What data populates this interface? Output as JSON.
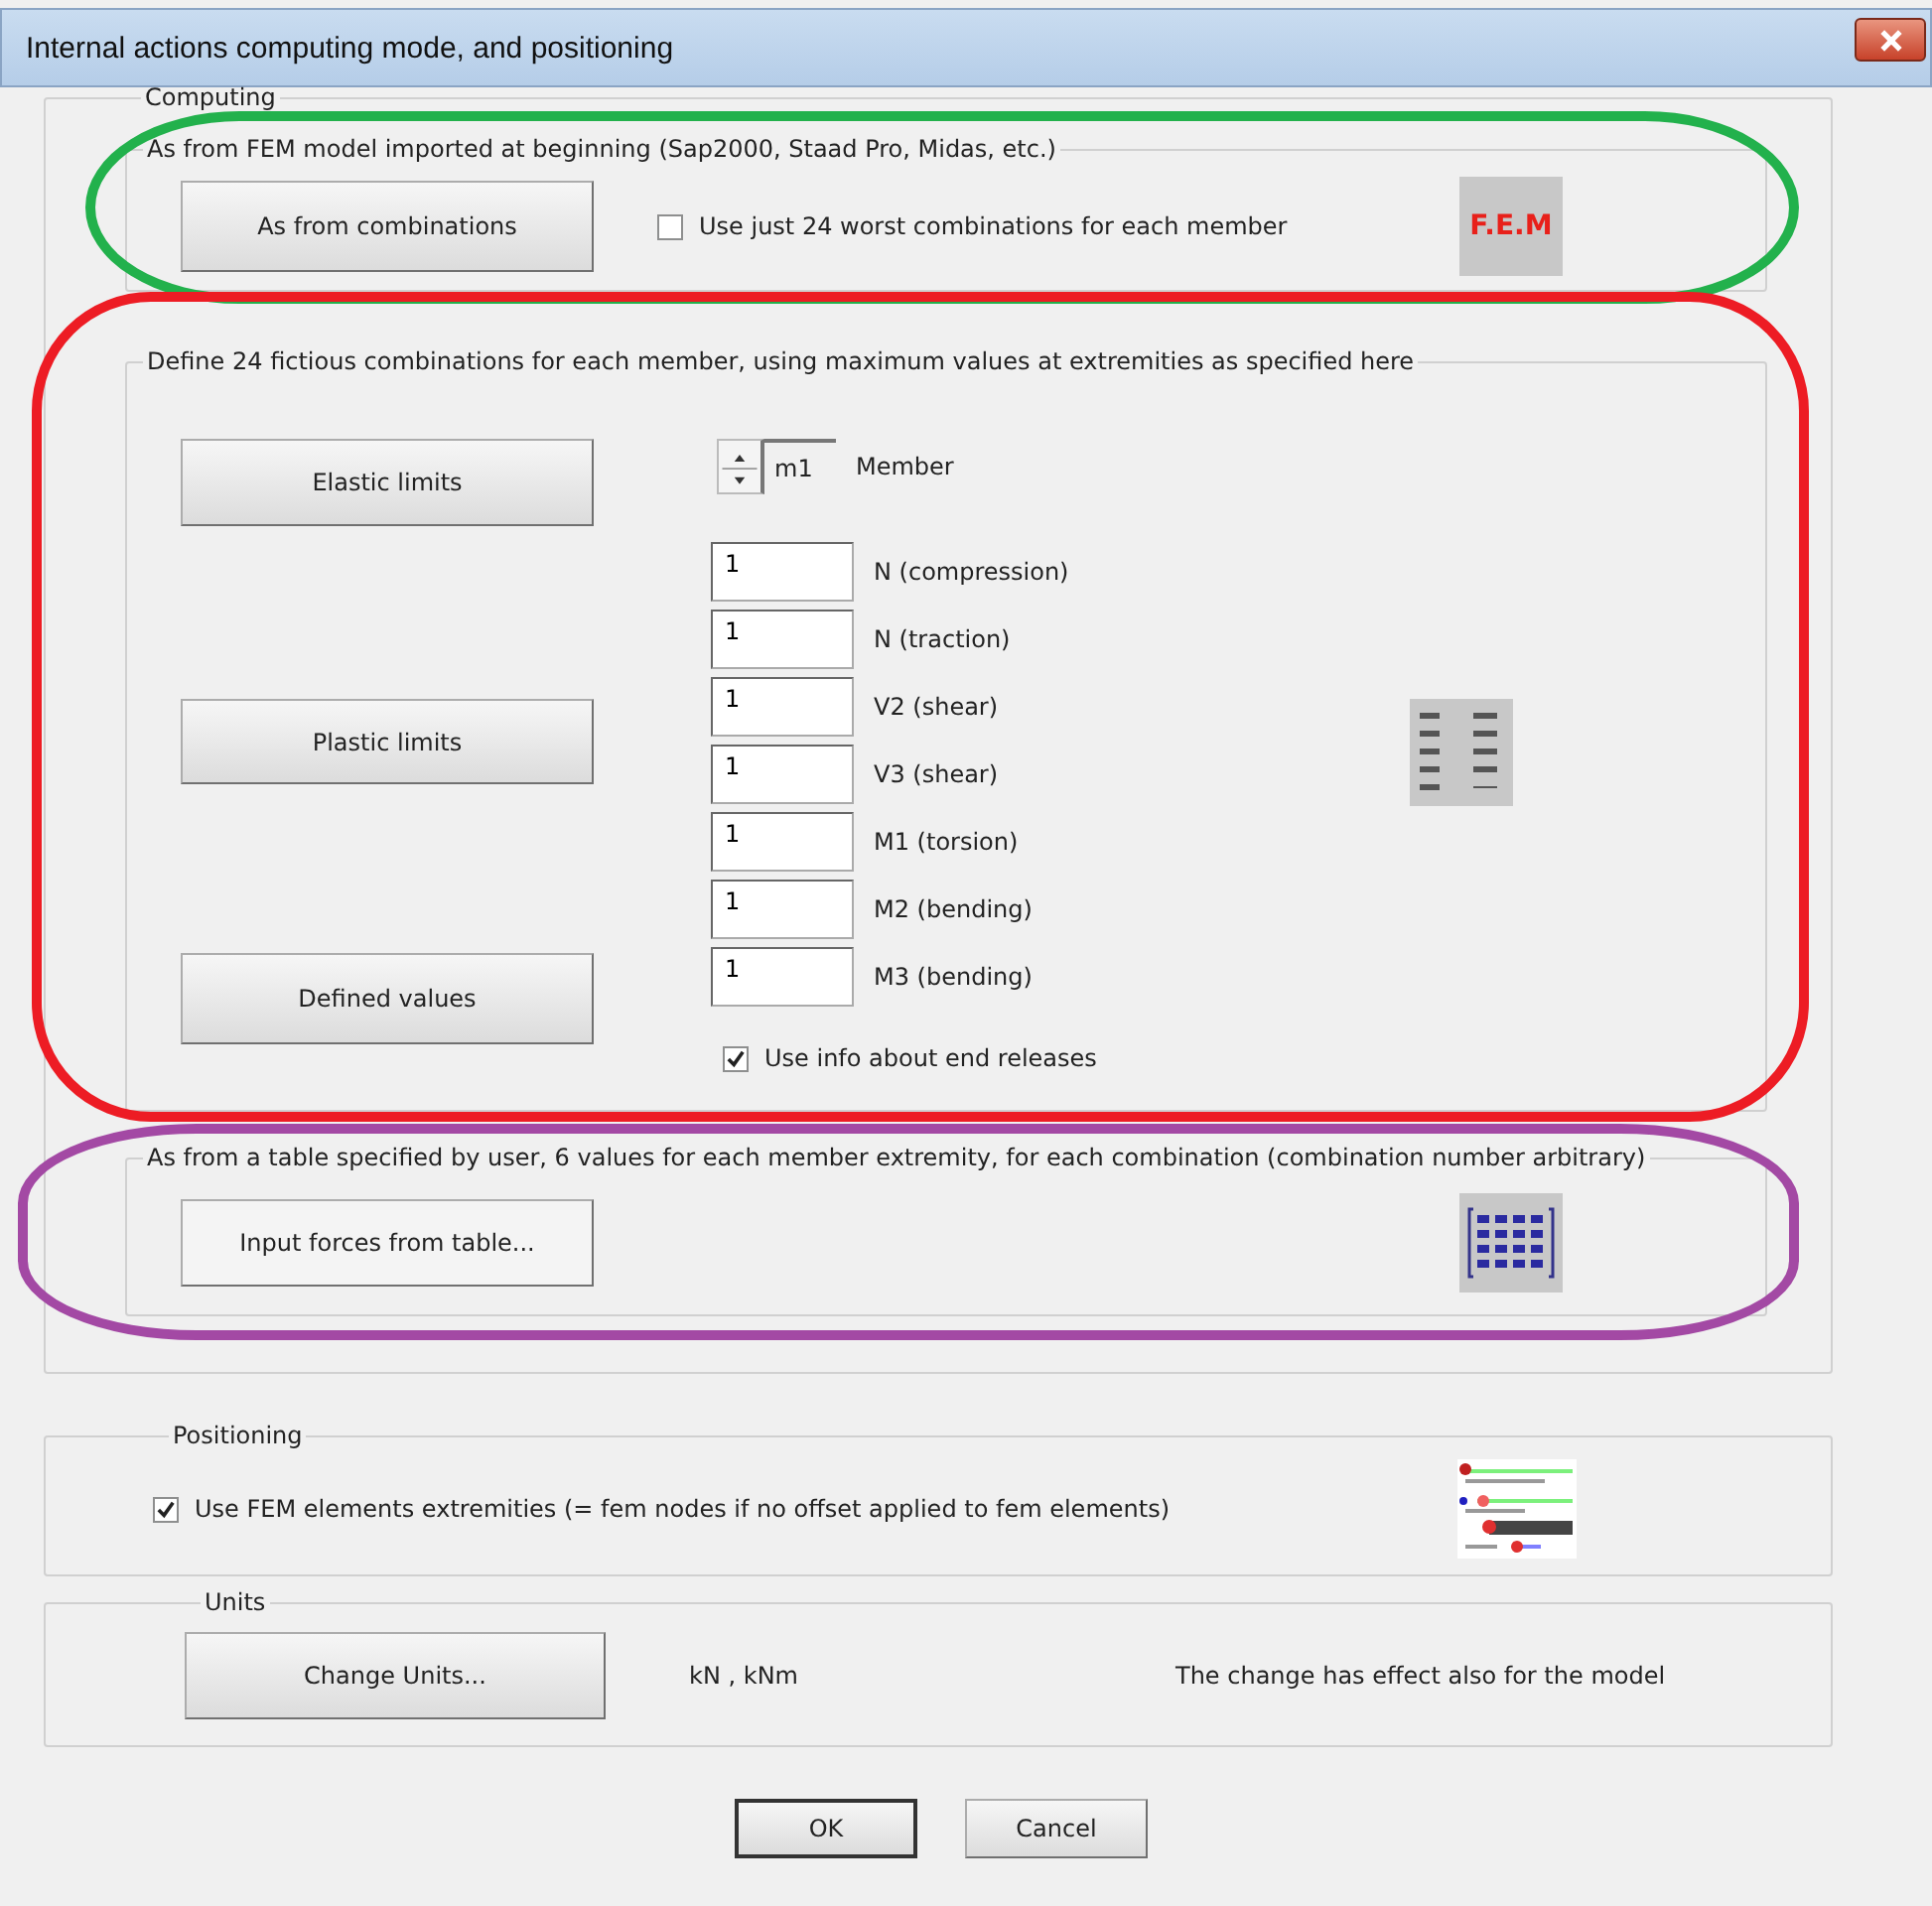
{
  "window": {
    "title": "Internal actions computing mode, and positioning"
  },
  "computing": {
    "label": "Computing",
    "fem_group": {
      "label": "As from FEM model imported at beginning (Sap2000, Staad Pro, Midas, etc.)",
      "color": "#22b14c",
      "button": "As from combinations",
      "worst_only": {
        "label": "Use just 24 worst combinations for each member",
        "checked": false
      },
      "badge": "F.E.M"
    },
    "fictitious_group": {
      "label": "Define 24 fictious combinations for each member, using maximum values at extremities as specified here",
      "color": "#ed1c24",
      "buttons": [
        "Elastic limits",
        "Plastic limits",
        "Defined values"
      ],
      "member": {
        "value": "m1",
        "label": "Member"
      },
      "values": [
        {
          "value": "1",
          "label": "N (compression)"
        },
        {
          "value": "1",
          "label": "N (traction)"
        },
        {
          "value": "1",
          "label": "V2 (shear)"
        },
        {
          "value": "1",
          "label": "V3 (shear)"
        },
        {
          "value": "1",
          "label": "M1 (torsion)"
        },
        {
          "value": "1",
          "label": "M2 (bending)"
        },
        {
          "value": "1",
          "label": "M3 (bending)"
        }
      ],
      "end_releases": {
        "label": "Use info about end releases",
        "checked": true
      }
    },
    "table_group": {
      "label": "As from a table specified by user, 6 values for each member extremity, for each combination (combination number arbitrary)",
      "color": "#a349a4",
      "button": "Input forces from table..."
    }
  },
  "positioning": {
    "label": "Positioning",
    "fem_extremities": {
      "label": "Use FEM elements extremities (= fem nodes if no offset applied to fem elements)",
      "checked": true
    }
  },
  "units": {
    "label": "Units",
    "button": "Change Units...",
    "units": "kN ,  kNm",
    "note": "The change has effect also for the model"
  },
  "buttons": [
    {
      "label": "OK",
      "default": true
    },
    {
      "label": "Cancel",
      "default": false
    }
  ]
}
